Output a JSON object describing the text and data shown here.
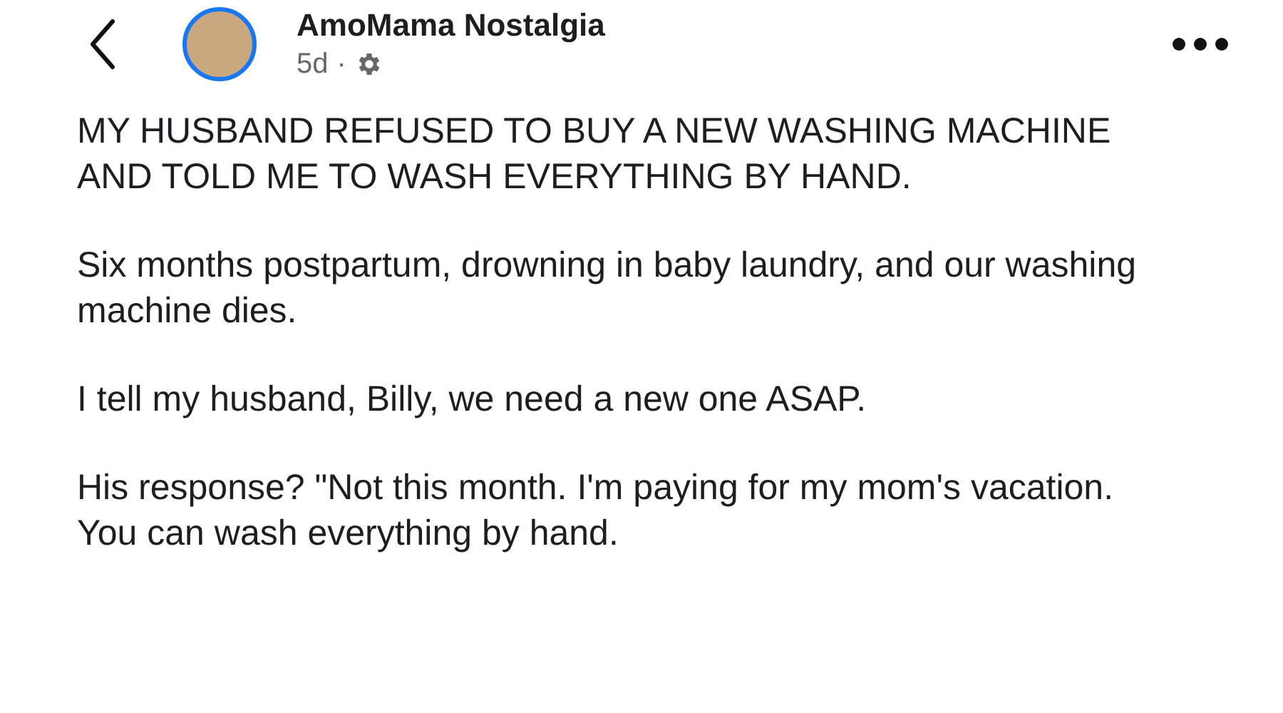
{
  "header": {
    "author": "AmoMama Nostalgia",
    "time": "5d",
    "separator": "·"
  },
  "paragraphs": [
    "MY HUSBAND REFUSED TO BUY A NEW WASHING MACHINE AND TOLD ME TO WASH EVERYTHING BY HAND.",
    "Six months postpartum, drowning in baby laundry, and our washing machine dies.",
    "I tell my husband, Billy, we need a new one ASAP.",
    "His response? \"Not this month. I'm paying for my mom's vacation. You can wash everything by hand."
  ]
}
